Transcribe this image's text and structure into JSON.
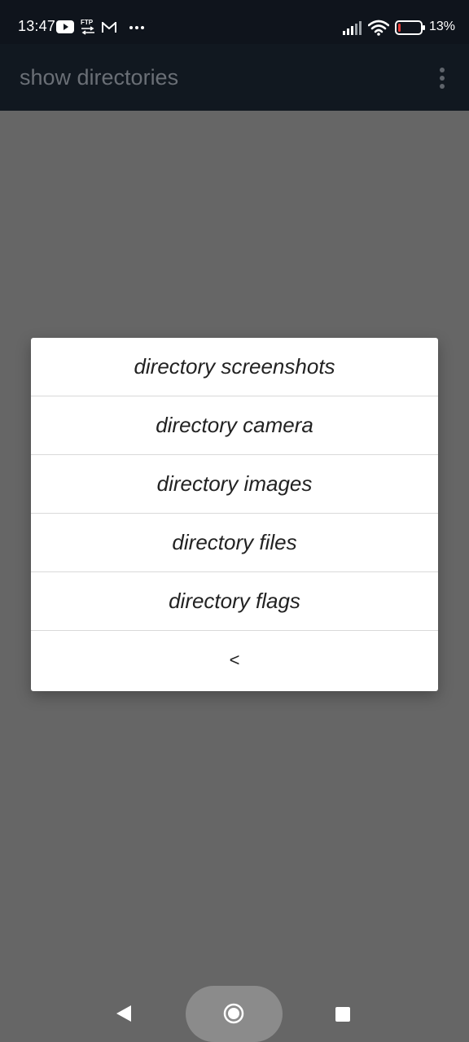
{
  "status_bar": {
    "time": "13:47",
    "battery_percent_label": "13%",
    "battery_level": 0.13,
    "battery_color": "#e53935",
    "icons": [
      "youtube-icon",
      "ftp-icon",
      "gmail-icon",
      "more-notifications-icon",
      "signal-icon",
      "wifi-icon",
      "battery-icon"
    ]
  },
  "app_bar": {
    "title": "show directories",
    "menu_icon": "overflow-menu-icon"
  },
  "dialog": {
    "items": [
      {
        "label": "directory screenshots"
      },
      {
        "label": "directory camera"
      },
      {
        "label": "directory images"
      },
      {
        "label": "directory files"
      },
      {
        "label": "directory flags"
      },
      {
        "label": "<"
      }
    ]
  },
  "nav_bar": {
    "icons": [
      "back-icon",
      "home-icon",
      "recents-icon"
    ]
  },
  "colors": {
    "scrim": "#666666",
    "app_bar": "#111820",
    "status_bar": "#0f141c",
    "dialog_bg": "#ffffff",
    "divider": "#d9d9d9"
  }
}
